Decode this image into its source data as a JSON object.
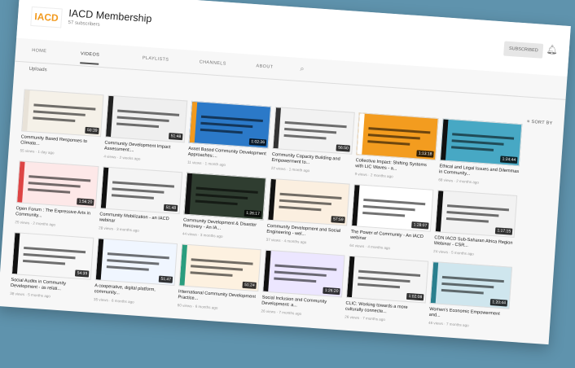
{
  "channel": {
    "logo_text": "IACD",
    "logo_subtext": "",
    "title": "IACD Membership",
    "subscribers": "57 subscribers",
    "subscribe_label": "SUBSCRIBED"
  },
  "tabs": [
    "HOME",
    "VIDEOS",
    "PLAYLISTS",
    "CHANNELS",
    "ABOUT"
  ],
  "section_label": "Uploads",
  "sort_label": "SORT BY",
  "colors": {
    "background": "#5f93ad",
    "page": "#f7f7f7",
    "accent_orange": "#f29a1e"
  },
  "videos": [
    {
      "title": "Community Based Responses to Climate...",
      "meta": "55 views · 1 day ago",
      "duration": "50:39",
      "color": "#f5f1e8",
      "bar": "#e8e2d8"
    },
    {
      "title": "Community Development Impact Assessment:...",
      "meta": "4 views · 2 weeks ago",
      "duration": "51:48",
      "color": "#efefef",
      "bar": "#222"
    },
    {
      "title": "Asset Based Community Development Approaches:...",
      "meta": "11 views · 1 month ago",
      "duration": "1:02:26",
      "color": "#2b79c8",
      "bar": "#f29a1e"
    },
    {
      "title": "Community Capacity Building and Empowerment to...",
      "meta": "22 views · 1 month ago",
      "duration": "56:50",
      "color": "#f2f2f2",
      "bar": "#333"
    },
    {
      "title": "Collective Impact: Shifting Systems with LIC Waves - a...",
      "meta": "9 views · 2 months ago",
      "duration": "1:13:18",
      "color": "#f39c1f",
      "bar": "#ffffff"
    },
    {
      "title": "Ethical and Legal Issues and Dilemmas in Community...",
      "meta": "68 views · 2 months ago",
      "duration": "1:24:44",
      "color": "#47a8c4",
      "bar": "#111"
    },
    {
      "title": "Open Forum : The Expressive Arts in Community...",
      "meta": "25 views · 2 months ago",
      "duration": "1:56:20",
      "color": "#fde8e8",
      "bar": "#d44"
    },
    {
      "title": "Community Mobilization - an IACD webinar",
      "meta": "28 views · 3 months ago",
      "duration": "51:48",
      "color": "#f4f4f4",
      "bar": "#111"
    },
    {
      "title": "Community Development & Disaster Recovery - An IA...",
      "meta": "44 views · 3 months ago",
      "duration": "1:26:17",
      "color": "#2f3d30",
      "bar": "#111"
    },
    {
      "title": "Community Development and Social Engineering - wel...",
      "meta": "37 views · 4 months ago",
      "duration": "57:59",
      "color": "#fbefe0",
      "bar": "#111"
    },
    {
      "title": "The Power of Community - An IACD webinar",
      "meta": "64 views · 4 months ago",
      "duration": "1:28:07",
      "color": "#ffffff",
      "bar": "#111"
    },
    {
      "title": "CDN IACD Sub-Saharan Africa Region Webinar - CSR...",
      "meta": "24 views · 5 months ago",
      "duration": "1:17:15",
      "color": "#f2f2f2",
      "bar": "#111"
    },
    {
      "title": "Social Audits in Community Development - as relati...",
      "meta": "38 views · 5 months ago",
      "duration": "54:39",
      "color": "#f7f7f7",
      "bar": "#111"
    },
    {
      "title": "A cooperative, digital platform, community...",
      "meta": "35 views · 6 months ago",
      "duration": "51:47",
      "color": "#f0f6ff",
      "bar": "#111"
    },
    {
      "title": "International Community Development Practice...",
      "meta": "60 views · 6 months ago",
      "duration": "51:24",
      "color": "#fdf1e0",
      "bar": "#2a9d7e"
    },
    {
      "title": "Social Inclusion and Community Development: a...",
      "meta": "26 views · 7 months ago",
      "duration": "1:26:20",
      "color": "#ece6ff",
      "bar": "#111"
    },
    {
      "title": "CLIC: Working towards a more culturally connecte...",
      "meta": "26 views · 7 months ago",
      "duration": "1:02:08",
      "color": "#f4f4f4",
      "bar": "#111"
    },
    {
      "title": "Women's Economic Empowerment and...",
      "meta": "46 views · 7 months ago",
      "duration": "1:20:44",
      "color": "#cfe6ee",
      "bar": "#2a7f8e"
    }
  ]
}
